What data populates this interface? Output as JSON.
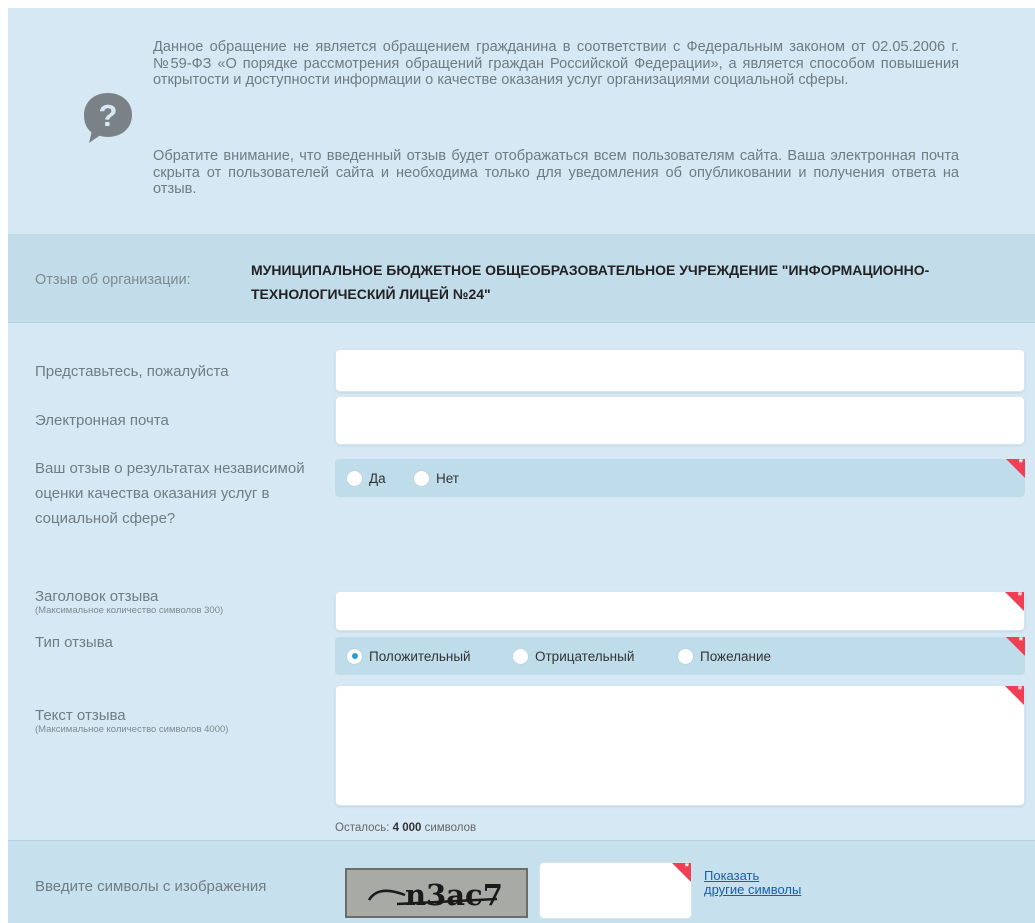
{
  "notice": {
    "paragraph1": "Данное обращение не является обращением гражданина в соответствии с Федеральным законом от 02.05.2006 г. №59-ФЗ «О порядке рассмотрения обращений граждан Российской Федерации», а является способом повышения открытости и доступности информации о качестве оказания услуг организациями социальной сферы.",
    "paragraph2": "Обратите внимание, что введенный отзыв будет отображаться всем пользователям сайта. Ваша электронная почта скрыта от пользователей сайта и необходима только для уведомления об опубликовании и получения ответа на отзыв."
  },
  "organization": {
    "label": "Отзыв об организации:",
    "name": "МУНИЦИПАЛЬНОЕ БЮДЖЕТНОЕ ОБЩЕОБРАЗОВАТЕЛЬНОЕ УЧРЕЖДЕНИЕ \"ИНФОРМАЦИОННО-ТЕХНОЛОГИЧЕСКИЙ ЛИЦЕЙ №24\""
  },
  "form": {
    "name": {
      "label": "Представьтесь, пожалуйста",
      "value": ""
    },
    "email": {
      "label": "Электронная почта",
      "value": ""
    },
    "independent_eval": {
      "label": "Ваш отзыв о результатах независимой оценки качества оказания услуг в социальной сфере?",
      "options": [
        "Да",
        "Нет"
      ],
      "selected": null
    },
    "title": {
      "label": "Заголовок отзыва",
      "hint": "(Максимальное количество символов 300)",
      "value": ""
    },
    "type": {
      "label": "Тип отзыва",
      "options": [
        "Положительный",
        "Отрицательный",
        "Пожелание"
      ],
      "selected": "Положительный"
    },
    "text": {
      "label": "Текст отзыва",
      "hint": "(Максимальное количество символов 4000)",
      "value": ""
    },
    "remaining": {
      "prefix": "Осталось:",
      "count": "4 000",
      "suffix": "символов"
    },
    "required_mark": "*"
  },
  "captcha": {
    "label": "Введите символы с изображения",
    "image_text": "n3ac7",
    "value": "",
    "link_line1": "Показать",
    "link_line2": "другие символы"
  },
  "colors": {
    "background": "#d5e8f3",
    "band": "#c2dcea",
    "required": "#ee3f54",
    "radio_selected": "#2a9fd6",
    "link": "#1a5ea8"
  }
}
